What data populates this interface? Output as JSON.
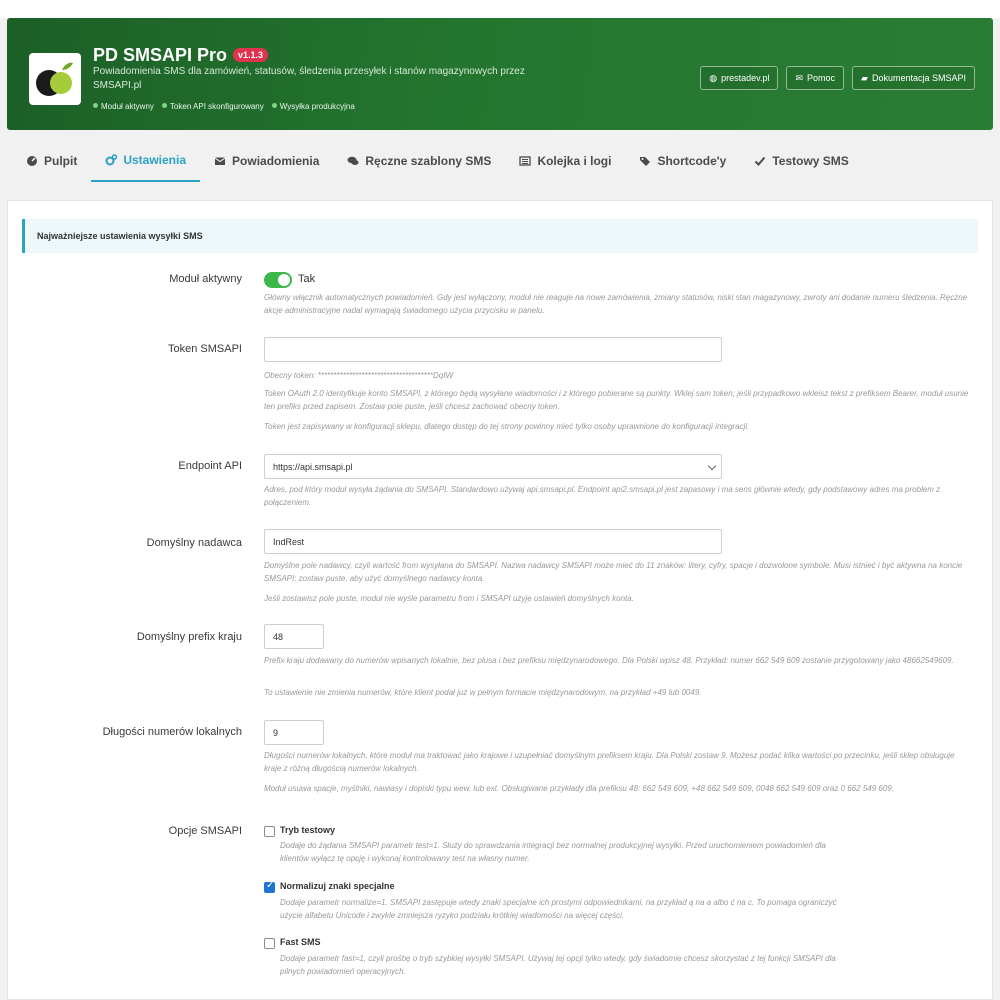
{
  "header": {
    "title": "PD SMSAPI Pro",
    "version": "v1.1.3",
    "description": "Powiadomienia SMS dla zamówień, statusów, śledzenia przesyłek i stanów magazynowych przez SMSAPI.pl",
    "statuses": [
      "Moduł aktywny",
      "Token API skonfigurowany",
      "Wysyłka produkcyjna"
    ],
    "buttons": [
      "prestadev.pl",
      "Pomoc",
      "Dokumentacja SMSAPI"
    ]
  },
  "tabs": [
    "Pulpit",
    "Ustawienia",
    "Powiadomienia",
    "Ręczne szablony SMS",
    "Kolejka i logi",
    "Shortcode'y",
    "Testowy SMS"
  ],
  "active_tab": "Ustawienia",
  "notice": "Najważniejsze ustawienia wysyłki SMS",
  "settings": {
    "module_active": {
      "label": "Moduł aktywny",
      "toggle_label": "Tak",
      "enabled": true,
      "help": "Główny włącznik automatycznych powiadomień. Gdy jest wyłączony, moduł nie reaguje na nowe zamówienia, zmiany statusów, niski stan magazynowy, zwroty ani dodanie numeru śledzenia. Ręczne akcje administracyjne nadal wymagają świadomego użycia przycisku w panelu."
    },
    "token": {
      "label": "Token SMSAPI",
      "value": "",
      "current": "Obecny token: *************************************DqIW",
      "help1": "Token OAuth 2.0 identyfikuje konto SMSAPI, z którego będą wysyłane wiadomości i z którego pobierane są punkty. Wklej sam token; jeśli przypadkowo wkleisz tekst z prefiksem Bearer, moduł usunie ten prefiks przed zapisem. Zostaw pole puste, jeśli chcesz zachować obecny token.",
      "help2": "Token jest zapisywany w konfiguracji sklepu, dlatego dostęp do tej strony powinny mieć tylko osoby uprawnione do konfiguracji integracji."
    },
    "endpoint": {
      "label": "Endpoint API",
      "value": "https://api.smsapi.pl",
      "help": "Adres, pod który moduł wysyła żądania do SMSAPI. Standardowo używaj api.smsapi.pl. Endpoint api2.smsapi.pl jest zapasowy i ma sens głównie wtedy, gdy podstawowy adres ma problem z połączeniem."
    },
    "sender": {
      "label": "Domyślny nadawca",
      "value": "IndRest",
      "help1": "Domyślne pole nadawcy, czyli wartość from wysyłana do SMSAPI. Nazwa nadawcy SMSAPI może mieć do 11 znaków: litery, cyfry, spacje i dozwolone symbole. Musi istnieć i być aktywna na koncie SMSAPI; zostaw puste, aby użyć domyślnego nadawcy konta.",
      "help2": "Jeśli zostawisz pole puste, moduł nie wyśle parametru from i SMSAPI użyje ustawień domyślnych konta."
    },
    "prefix": {
      "label": "Domyślny prefix kraju",
      "value": "48",
      "help1": "Prefix kraju dodawany do numerów wpisanych lokalnie, bez plusa i bez prefiksu międzynarodowego. Dla Polski wpisz 48. Przykład: numer 662 549 609 zostanie przygotowany jako 48662549609.",
      "help2": "To ustawienie nie zmienia numerów, które klient podał już w pełnym formacie międzynarodowym, na przykład +49 lub 0049."
    },
    "lengths": {
      "label": "Długości numerów lokalnych",
      "value": "9",
      "help1": "Długości numerów lokalnych, które moduł ma traktować jako krajowe i uzupełniać domyślnym prefiksem kraju. Dla Polski zostaw 9. Możesz podać kilka wartości po przecinku, jeśli sklep obsługuje kraje z różną długością numerów lokalnych.",
      "help2": "Moduł usuwa spacje, myślniki, nawiasy i dopiski typu wew. lub ext. Obsługiwane przykłady dla prefiksu 48: 662 549 609, +48 662 549 609, 0048 662 549 609 oraz 0 662 549 609."
    },
    "options": {
      "label": "Opcje SMSAPI",
      "items": [
        {
          "label": "Tryb testowy",
          "checked": false,
          "help": "Dodaje do żądania SMSAPI parametr test=1. Służy do sprawdzania integracji bez normalnej produkcyjnej wysyłki. Przed uruchomieniem powiadomień dla klientów wyłącz tę opcję i wykonaj kontrolowany test na własny numer."
        },
        {
          "label": "Normalizuj znaki specjalne",
          "checked": true,
          "help": "Dodaje parametr normalize=1. SMSAPI zastępuje wtedy znaki specjalne ich prostymi odpowiednikami, na przykład ą na a albo ć na c. To pomaga ograniczyć użycie alfabetu Unicode i zwykle zmniejsza ryzyko podziału krótkiej wiadomości na więcej części."
        },
        {
          "label": "Fast SMS",
          "checked": false,
          "help": "Dodaje parametr fast=1, czyli prośbę o tryb szybkiej wysyłki SMSAPI. Używaj tej opcji tylko wtedy, gdy świadomie chcesz skorzystać z tej funkcji SMSAPI dla pilnych powiadomień operacyjnych."
        }
      ]
    }
  }
}
